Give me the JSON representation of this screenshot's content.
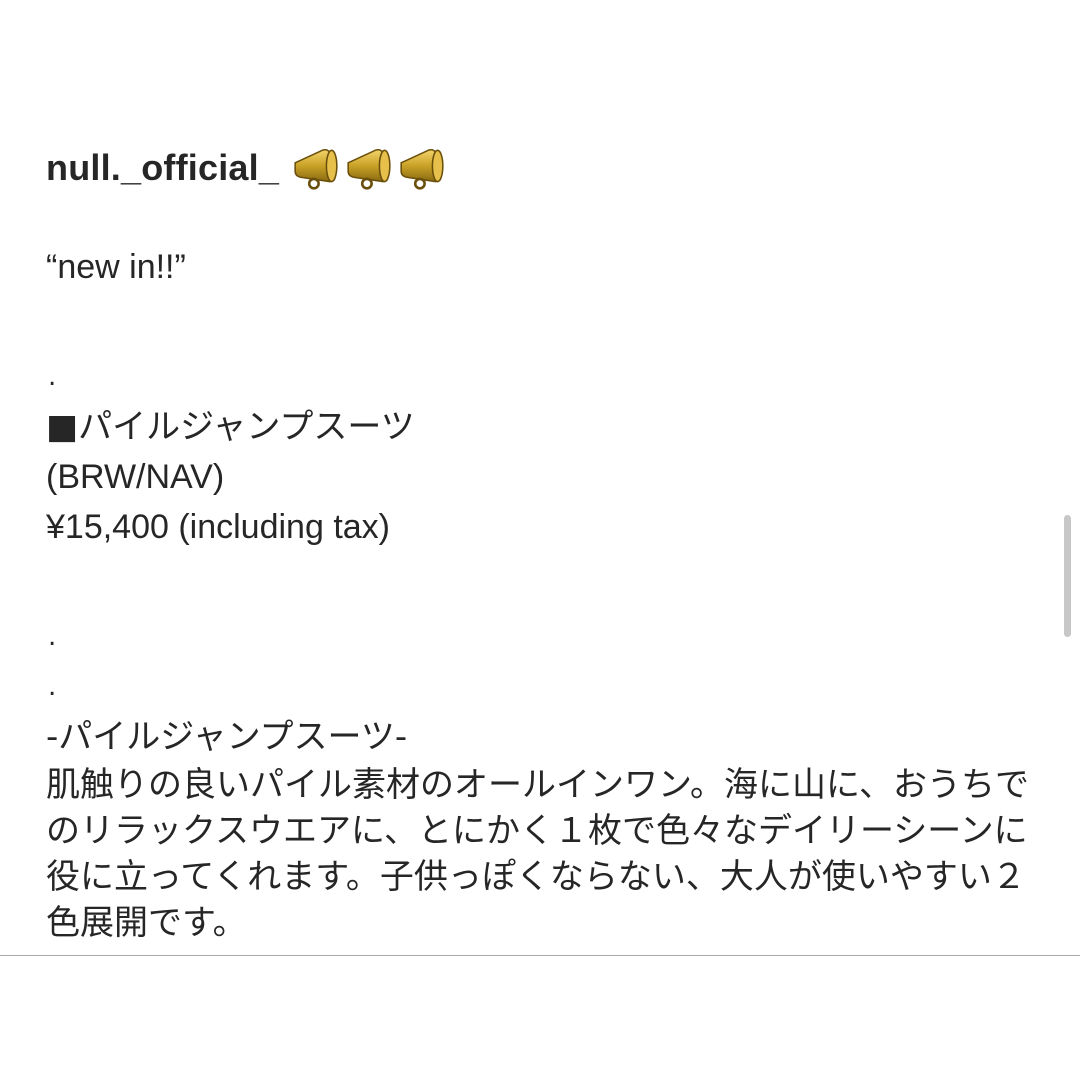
{
  "post": {
    "username": "null._official_",
    "icons": [
      "megaphone-icon",
      "megaphone-icon",
      "megaphone-icon"
    ],
    "headline": "“new in!!”",
    "separator": ".",
    "product_name_line": "■パイルジャンプスーツ",
    "colors": "(BRW/NAV)",
    "price": "¥15,400 (including tax)",
    "section_title": "-パイルジャンプスーツ-",
    "description": "肌触りの良いパイル素材のオールインワン。海に山に、おうちでのリラックスウエアに、とにかく１枚で色々なデイリーシーンに役に立ってくれます。子供っぽくならない、大人が使いやすい２色展開です。"
  },
  "colors_used": {
    "text": "#262626",
    "divider": "#a8a8a8",
    "scrollbar": "#c7c7c7",
    "megaphone": "#c9a227"
  }
}
